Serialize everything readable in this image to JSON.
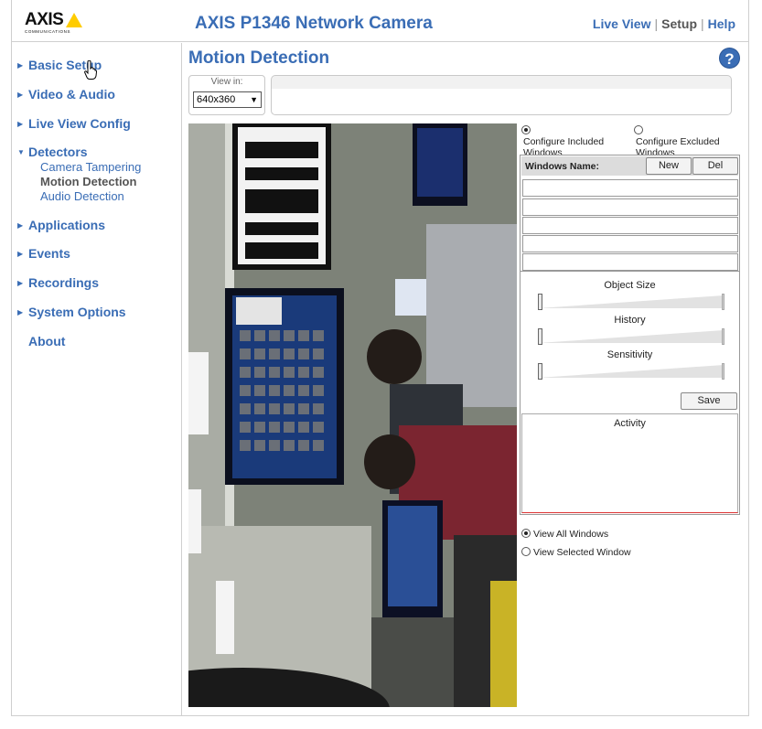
{
  "header": {
    "logo_text": "AXIS",
    "logo_sub": "COMMUNICATIONS",
    "title": "AXIS P1346 Network Camera",
    "nav": [
      {
        "label": "Live View"
      },
      {
        "label": "Setup"
      },
      {
        "label": "Help"
      }
    ]
  },
  "sidebar": {
    "items": [
      {
        "label": "Basic Setup"
      },
      {
        "label": "Video & Audio"
      },
      {
        "label": "Live View Config"
      },
      {
        "label": "Detectors"
      },
      {
        "label": "Applications"
      },
      {
        "label": "Events"
      },
      {
        "label": "Recordings"
      },
      {
        "label": "System Options"
      },
      {
        "label": "About"
      }
    ],
    "detectors_sub": [
      {
        "label": "Camera Tampering"
      },
      {
        "label": "Motion Detection"
      },
      {
        "label": "Audio Detection"
      }
    ]
  },
  "main": {
    "title": "Motion Detection",
    "help_icon": "?",
    "view_in_label": "View in:",
    "view_in_value": "640x360",
    "config": {
      "included_label": "Configure Included Windows",
      "excluded_label": "Configure Excluded Windows"
    },
    "windows": {
      "header_label": "Windows Name:",
      "new_label": "New",
      "del_label": "Del"
    },
    "sliders": {
      "object_size": "Object Size",
      "history": "History",
      "sensitivity": "Sensitivity"
    },
    "save_label": "Save",
    "activity_label": "Activity",
    "view_options": {
      "all": "View All Windows",
      "selected": "View Selected Window"
    }
  },
  "colors": {
    "link_blue": "#3a6db5",
    "logo_yellow": "#ffcc00"
  }
}
